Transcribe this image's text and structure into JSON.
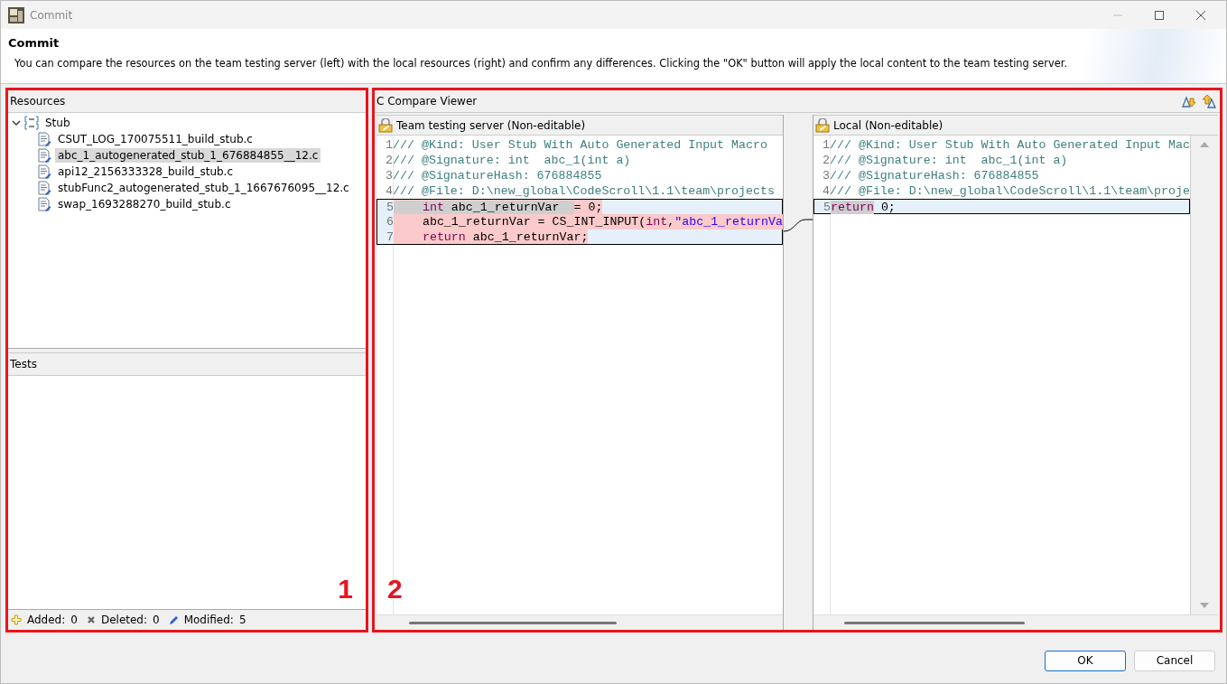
{
  "window": {
    "title": "Commit"
  },
  "header": {
    "title": "Commit",
    "description": "You can compare the resources on the team testing server (left) with the local resources (right) and confirm any differences. Clicking the \"OK\" button will apply the local content to the team testing server."
  },
  "resources": {
    "title": "Resources",
    "tree": [
      {
        "label": "Stub",
        "expanded": true,
        "children": [
          {
            "label": "CSUT_LOG_170075511_build_stub.c",
            "selected": false
          },
          {
            "label": "abc_1_autogenerated_stub_1_676884855__12.c",
            "selected": true
          },
          {
            "label": "api12_2156333328_build_stub.c",
            "selected": false
          },
          {
            "label": "stubFunc2_autogenerated_stub_1_1667676095__12.c",
            "selected": false
          },
          {
            "label": "swap_1693288270_build_stub.c",
            "selected": false
          }
        ]
      }
    ]
  },
  "tests": {
    "title": "Tests"
  },
  "status_bar": [
    {
      "kind": "added",
      "label": "Added:",
      "value": "0"
    },
    {
      "kind": "deleted",
      "label": "Deleted:",
      "value": "0"
    },
    {
      "kind": "modified",
      "label": "Modified:",
      "value": "5"
    }
  ],
  "left_annotation": {
    "label": "1"
  },
  "compare": {
    "title": "C Compare Viewer",
    "annotation": {
      "label": "2"
    },
    "panes": [
      {
        "title": "Team testing server (Non-editable)",
        "lines": [
          {
            "number": "1",
            "in_block": false,
            "changed": false,
            "segments": [
              {
                "text": "/// @Kind: User Stub With Auto Generated Input Macro",
                "kind": "comment",
                "highlight": false
              }
            ]
          },
          {
            "number": "2",
            "in_block": false,
            "changed": false,
            "segments": [
              {
                "text": "/// @Signature: int  abc_1(int a)",
                "kind": "comment",
                "highlight": false
              }
            ]
          },
          {
            "number": "3",
            "in_block": false,
            "changed": false,
            "segments": [
              {
                "text": "/// @SignatureHash: 676884855",
                "kind": "comment",
                "highlight": false
              }
            ]
          },
          {
            "number": "4",
            "in_block": false,
            "changed": false,
            "segments": [
              {
                "text": "/// @File: D:\\new_global\\CodeScroll\\1.1\\team\\projects",
                "kind": "comment",
                "highlight": false
              }
            ]
          },
          {
            "number": "5",
            "in_block": true,
            "changed": true,
            "segments": [
              {
                "text": "    int",
                "kind": "keyword",
                "highlight": true
              },
              {
                "text": " abc_1_returnVar  ",
                "kind": "plain",
                "highlight": true
              },
              {
                "text": "= 0;",
                "kind": "plain",
                "highlight": false
              }
            ]
          },
          {
            "number": "6",
            "in_block": true,
            "changed": true,
            "segments": [
              {
                "text": "    abc_1_returnVar = CS_INT_INPUT(",
                "kind": "plain",
                "highlight": false
              },
              {
                "text": "int",
                "kind": "keyword",
                "highlight": false
              },
              {
                "text": ",",
                "kind": "plain",
                "highlight": false
              },
              {
                "text": "\"abc_1_returnVa",
                "kind": "string",
                "highlight": false
              }
            ]
          },
          {
            "number": "7",
            "in_block": true,
            "changed": true,
            "segments": [
              {
                "text": "    return",
                "kind": "keyword",
                "highlight": false
              },
              {
                "text": " abc_1_returnVar;",
                "kind": "plain",
                "highlight": false
              }
            ]
          }
        ]
      },
      {
        "title": "Local (Non-editable)",
        "lines": [
          {
            "number": "1",
            "in_block": false,
            "changed": false,
            "segments": [
              {
                "text": "/// @Kind: User Stub With Auto Generated Input Mac",
                "kind": "comment",
                "highlight": false
              }
            ]
          },
          {
            "number": "2",
            "in_block": false,
            "changed": false,
            "segments": [
              {
                "text": "/// @Signature: int  abc_1(int a)",
                "kind": "comment",
                "highlight": false
              }
            ]
          },
          {
            "number": "3",
            "in_block": false,
            "changed": false,
            "segments": [
              {
                "text": "/// @SignatureHash: 676884855",
                "kind": "comment",
                "highlight": false
              }
            ]
          },
          {
            "number": "4",
            "in_block": false,
            "changed": false,
            "segments": [
              {
                "text": "/// @File: D:\\new_global\\CodeScroll\\1.1\\team\\proje",
                "kind": "comment",
                "highlight": false
              }
            ]
          },
          {
            "number": "5",
            "in_block": true,
            "changed": false,
            "segments": [
              {
                "text": "return",
                "kind": "keyword",
                "highlight": true
              },
              {
                "text": " 0;",
                "kind": "plain",
                "highlight": false
              }
            ]
          }
        ]
      }
    ]
  },
  "buttons": [
    {
      "label": "OK",
      "default": true
    },
    {
      "label": "Cancel",
      "default": false
    }
  ]
}
